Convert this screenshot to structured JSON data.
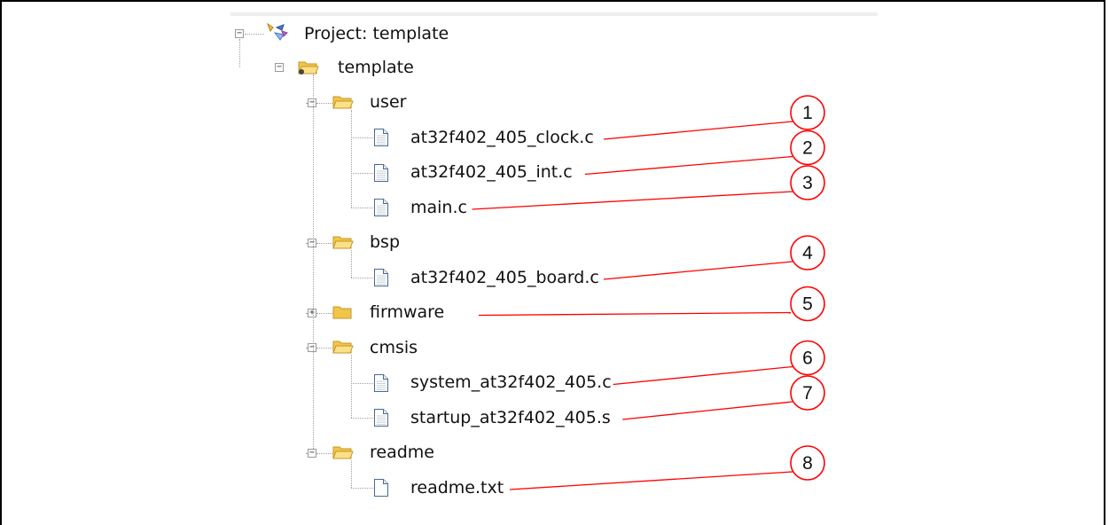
{
  "tree": {
    "project": {
      "label": "Project: template",
      "icon": "project-icon",
      "expanded": true
    },
    "target": {
      "label": "template",
      "icon": "target-folder-icon",
      "expanded": true
    },
    "groups": [
      {
        "label": "user",
        "expanded": true,
        "files": [
          {
            "label": "at32f402_405_clock.c",
            "callout": "1"
          },
          {
            "label": "at32f402_405_int.c",
            "callout": "2"
          },
          {
            "label": "main.c",
            "callout": "3"
          }
        ]
      },
      {
        "label": "bsp",
        "expanded": true,
        "files": [
          {
            "label": "at32f402_405_board.c",
            "callout": "4"
          }
        ]
      },
      {
        "label": "firmware",
        "expanded": false,
        "callout": "5",
        "files": []
      },
      {
        "label": "cmsis",
        "expanded": true,
        "files": [
          {
            "label": "system_at32f402_405.c",
            "callout": "6"
          },
          {
            "label": "startup_at32f402_405.s",
            "callout": "7"
          }
        ]
      },
      {
        "label": "readme",
        "expanded": true,
        "files": [
          {
            "label": "readme.txt",
            "callout": "8",
            "plain": true
          }
        ]
      }
    ]
  },
  "colors": {
    "callout": "#ff0000",
    "folder": "#f0c64a",
    "folder_dark": "#c8961e"
  },
  "toggle_symbols": {
    "expanded": "−",
    "collapsed": "+"
  }
}
